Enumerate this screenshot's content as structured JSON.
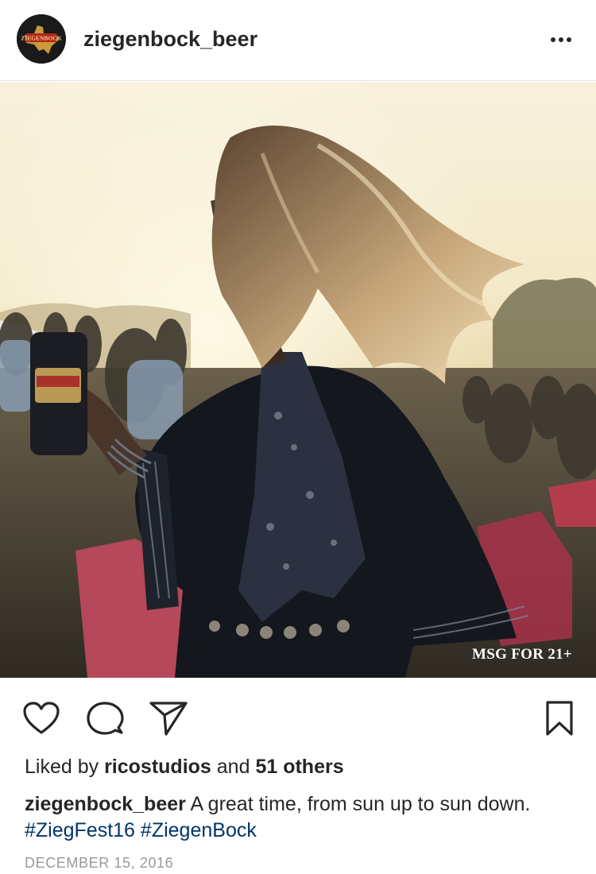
{
  "post": {
    "username": "ziegenbock_beer",
    "avatar_icon": "ziegenbock-logo-icon",
    "image_watermark": "MSG FOR 21+",
    "avatar_logo_text": "ZIEGENBOCK"
  },
  "actions": {
    "like_icon": "heart-icon",
    "comment_icon": "comment-icon",
    "share_icon": "send-icon",
    "save_icon": "bookmark-icon",
    "more_icon": "more-icon"
  },
  "likes": {
    "prefix": "Liked by",
    "user": "ricostudios",
    "connector": "and",
    "others": "51 others"
  },
  "caption": {
    "username": "ziegenbock_beer",
    "text": "A great time, from sun up to sun down.",
    "hashtags": [
      "#ZiegFest16",
      "#ZiegenBock"
    ]
  },
  "date": "DECEMBER 15, 2016"
}
